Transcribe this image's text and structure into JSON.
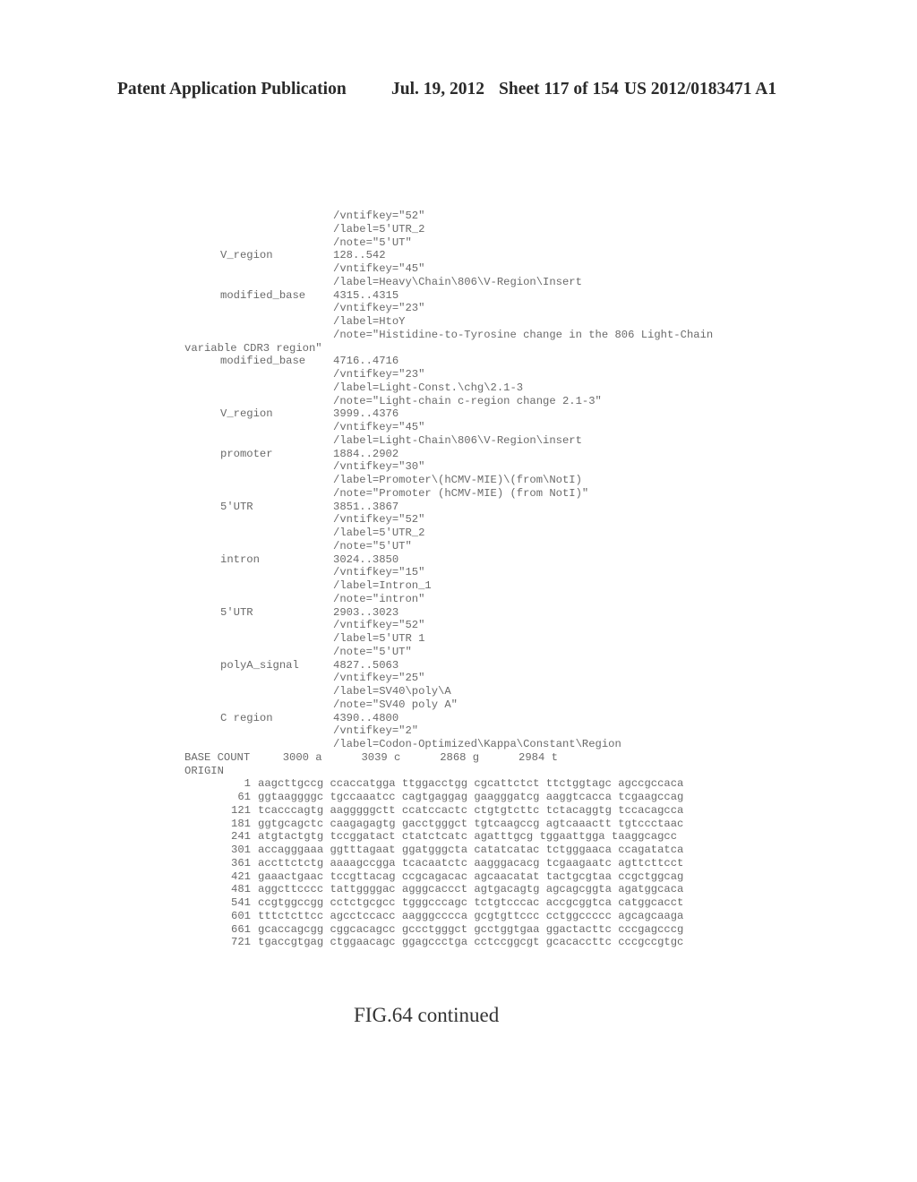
{
  "header": {
    "publication": "Patent Application Publication",
    "date": "Jul. 19, 2012",
    "sheet": "Sheet 117 of 154",
    "number": "US 2012/0183471 A1"
  },
  "listing": [
    {
      "key": "",
      "value": "/vntifkey=\"52\""
    },
    {
      "key": "",
      "value": "/label=5'UTR_2"
    },
    {
      "key": "",
      "value": "/note=\"5'UT\""
    },
    {
      "key": "V_region",
      "value": "128..542"
    },
    {
      "key": "",
      "value": "/vntifkey=\"45\""
    },
    {
      "key": "",
      "value": "/label=Heavy\\Chain\\806\\V-Region\\Insert"
    },
    {
      "key": "modified_base",
      "value": "4315..4315"
    },
    {
      "key": "",
      "value": "/vntifkey=\"23\""
    },
    {
      "key": "",
      "value": "/label=HtoY"
    },
    {
      "key": "",
      "value": "/note=\"Histidine-to-Tyrosine change in the 806 Light-Chain"
    },
    {
      "key": "",
      "value": "",
      "wrap": "variable CDR3 region\""
    },
    {
      "key": "modified_base",
      "value": "4716..4716"
    },
    {
      "key": "",
      "value": "/vntifkey=\"23\""
    },
    {
      "key": "",
      "value": "/label=Light-Const.\\chg\\2.1-3"
    },
    {
      "key": "",
      "value": "/note=\"Light-chain c-region change 2.1-3\""
    },
    {
      "key": "V_region",
      "value": "3999..4376"
    },
    {
      "key": "",
      "value": "/vntifkey=\"45\""
    },
    {
      "key": "",
      "value": "/label=Light-Chain\\806\\V-Region\\insert"
    },
    {
      "key": "promoter",
      "value": "1884..2902"
    },
    {
      "key": "",
      "value": "/vntifkey=\"30\""
    },
    {
      "key": "",
      "value": "/label=Promoter\\(hCMV-MIE)\\(from\\NotI)"
    },
    {
      "key": "",
      "value": "/note=\"Promoter (hCMV-MIE) (from NotI)\""
    },
    {
      "key": "5'UTR",
      "value": "3851..3867"
    },
    {
      "key": "",
      "value": "/vntifkey=\"52\""
    },
    {
      "key": "",
      "value": "/label=5'UTR_2"
    },
    {
      "key": "",
      "value": "/note=\"5'UT\""
    },
    {
      "key": "intron",
      "value": "3024..3850"
    },
    {
      "key": "",
      "value": "/vntifkey=\"15\""
    },
    {
      "key": "",
      "value": "/label=Intron_1"
    },
    {
      "key": "",
      "value": "/note=\"intron\""
    },
    {
      "key": "5'UTR",
      "value": "2903..3023"
    },
    {
      "key": "",
      "value": "/vntifkey=\"52\""
    },
    {
      "key": "",
      "value": "/label=5'UTR 1"
    },
    {
      "key": "",
      "value": "/note=\"5'UT\""
    },
    {
      "key": "polyA_signal",
      "value": "4827..5063"
    },
    {
      "key": "",
      "value": "/vntifkey=\"25\""
    },
    {
      "key": "",
      "value": "/label=SV40\\poly\\A"
    },
    {
      "key": "",
      "value": "/note=\"SV40 poly A\""
    },
    {
      "key": "C region",
      "value": "4390..4800"
    },
    {
      "key": "",
      "value": "/vntifkey=\"2\""
    },
    {
      "key": "",
      "value": "/label=Codon-Optimized\\Kappa\\Constant\\Region"
    }
  ],
  "base_count": {
    "label": "BASE COUNT",
    "text": "     3000 a      3039 c      2868 g      2984 t"
  },
  "origin_label": "ORIGIN",
  "sequence": [
    {
      "pos": "1",
      "blocks": [
        "aagcttgccg",
        "ccaccatgga",
        "ttggacctgg",
        "cgcattctct",
        "ttctggtagc",
        "agccgccaca"
      ]
    },
    {
      "pos": "61",
      "blocks": [
        "ggtaaggggc",
        "tgccaaatcc",
        "cagtgaggag",
        "gaagggatcg",
        "aaggtcacca",
        "tcgaagccag"
      ]
    },
    {
      "pos": "121",
      "blocks": [
        "tcacccagtg",
        "aagggggctt",
        "ccatccactc",
        "ctgtgtcttc",
        "tctacaggtg",
        "tccacagcca"
      ]
    },
    {
      "pos": "181",
      "blocks": [
        "ggtgcagctc",
        "caagagagtg",
        "gacctgggct",
        "tgtcaagccg",
        "agtcaaactt",
        "tgtccctaac"
      ]
    },
    {
      "pos": "241",
      "blocks": [
        "atgtactgtg",
        "tccggatact",
        "ctatctcatc",
        "agatttgcg",
        "tggaattgga",
        "taaggcagcc"
      ]
    },
    {
      "pos": "301",
      "blocks": [
        "accagggaaa",
        "ggtttagaat",
        "ggatgggcta",
        "catatcatac",
        "tctgggaaca",
        "ccagatatca"
      ]
    },
    {
      "pos": "361",
      "blocks": [
        "accttctctg",
        "aaaagccgga",
        "tcacaatctc",
        "aagggacacg",
        "tcgaagaatc",
        "agttcttcct"
      ]
    },
    {
      "pos": "421",
      "blocks": [
        "gaaactgaac",
        "tccgttacag",
        "ccgcagacac",
        "agcaacatat",
        "tactgcgtaa",
        "ccgctggcag"
      ]
    },
    {
      "pos": "481",
      "blocks": [
        "aggcttcccc",
        "tattggggac",
        "agggcaccct",
        "agtgacagtg",
        "agcagcggta",
        "agatggcaca"
      ]
    },
    {
      "pos": "541",
      "blocks": [
        "ccgtggccgg",
        "cctctgcgcc",
        "tgggcccagc",
        "tctgtcccac",
        "accgcggtca",
        "catggcacct"
      ]
    },
    {
      "pos": "601",
      "blocks": [
        "tttctcttcc",
        "agcctccacc",
        "aagggcccca",
        "gcgtgttccc",
        "cctggccccc",
        "agcagcaaga"
      ]
    },
    {
      "pos": "661",
      "blocks": [
        "gcaccagcgg",
        "cggcacagcc",
        "gccctgggct",
        "gcctggtgaa",
        "ggactacttc",
        "cccgagcccg"
      ]
    },
    {
      "pos": "721",
      "blocks": [
        "tgaccgtgag",
        "ctggaacagc",
        "ggagccctga",
        "cctccggcgt",
        "gcacaccttc",
        "cccgccgtgc"
      ]
    }
  ],
  "caption": "FIG.64 continued"
}
